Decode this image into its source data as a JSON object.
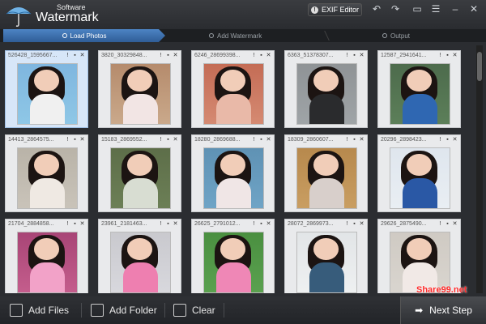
{
  "app": {
    "brand_small": "Software",
    "brand_big": "Watermark"
  },
  "toolbar": {
    "exif_label": "EXIF Editor",
    "icons": [
      "undo-icon",
      "redo-icon",
      "chat-icon",
      "info-icon",
      "minimize-icon",
      "close-icon"
    ]
  },
  "steps": [
    {
      "label": "Load Photos",
      "active": true
    },
    {
      "label": "Add Watermark",
      "active": false
    },
    {
      "label": "Output",
      "active": false
    }
  ],
  "photos": [
    {
      "name": "526428_1595667...",
      "bg": "#8ec7e6",
      "top": "#7fb6df",
      "body": "#f0f0f0",
      "selected": true
    },
    {
      "name": "3820_30329848...",
      "bg": "#caa98b",
      "top": "#b58b6c",
      "body": "#f2e5e4"
    },
    {
      "name": "6246_28699398...",
      "bg": "#d58a72",
      "top": "#c46c55",
      "body": "#e9b9a8"
    },
    {
      "name": "6363_51378307...",
      "bg": "#9fa4a7",
      "top": "#8f9396",
      "body": "#2a2b2d"
    },
    {
      "name": "12587_2941641...",
      "bg": "#5c7f59",
      "top": "#4d6b4c",
      "body": "#2f67b2"
    },
    {
      "name": "14413_2864575...",
      "bg": "#c9c3b9",
      "top": "#b9b3a8",
      "body": "#efe9e3"
    },
    {
      "name": "15183_2869552...",
      "bg": "#6c7f56",
      "top": "#5d6e49",
      "body": "#d8ddd2"
    },
    {
      "name": "18280_2869688...",
      "bg": "#6fa4c6",
      "top": "#5f92b4",
      "body": "#f0e6e6"
    },
    {
      "name": "18309_2860607...",
      "bg": "#c99e62",
      "top": "#b7894d",
      "body": "#d8cfcb"
    },
    {
      "name": "20296_2898423...",
      "bg": "#e9eef3",
      "top": "#dfe6ee",
      "body": "#2a58a5"
    },
    {
      "name": "21704_2884858...",
      "bg": "#c45d8c",
      "top": "#a84576",
      "body": "#f2a2c8"
    },
    {
      "name": "23961_2181463...",
      "bg": "#d8d8dd",
      "top": "#c9c9ce",
      "body": "#ee7fb0"
    },
    {
      "name": "26625_2791012...",
      "bg": "#5aa14f",
      "top": "#4a8f40",
      "body": "#ef87b6"
    },
    {
      "name": "28072_2869973...",
      "bg": "#eef0f1",
      "top": "#e2e5e7",
      "body": "#375c7b"
    },
    {
      "name": "29626_2875490...",
      "bg": "#d9d5cf",
      "top": "#cfcac3",
      "body": "#f1e9e6"
    }
  ],
  "bottom": {
    "add_files": "Add Files",
    "add_folder": "Add Folder",
    "clear": "Clear",
    "next_step": "Next Step",
    "watermark_text": "Share99.net"
  }
}
